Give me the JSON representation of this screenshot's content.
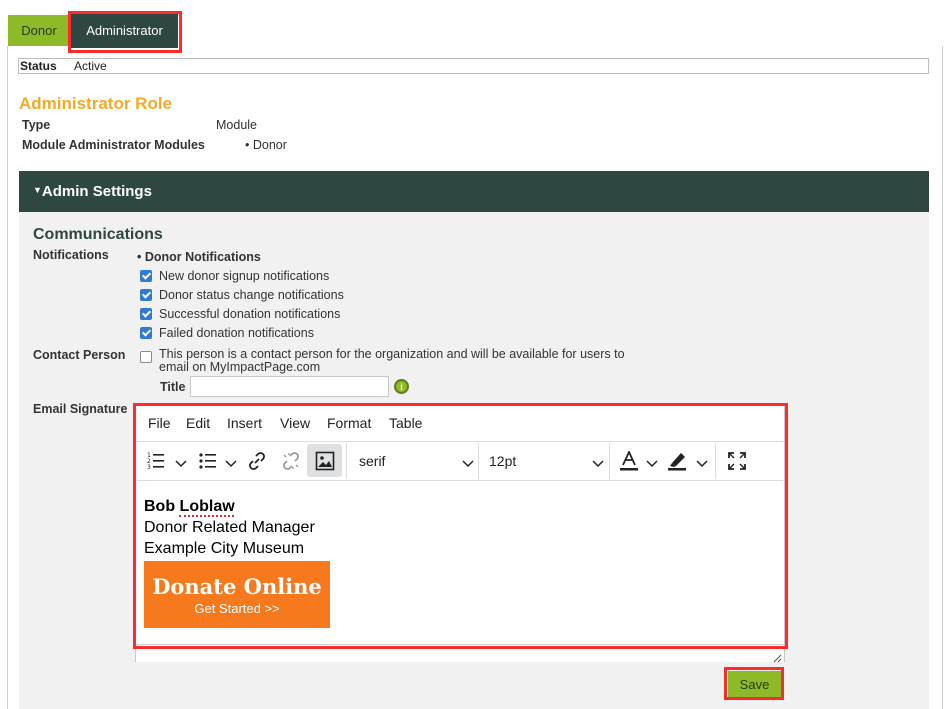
{
  "tabs": [
    {
      "label": "Donor",
      "active": false
    },
    {
      "label": "Administrator",
      "active": true
    }
  ],
  "status": {
    "label": "Status",
    "value": "Active"
  },
  "role": {
    "title": "Administrator Role",
    "type_label": "Type",
    "type_value": "Module",
    "modules_label": "Module Administrator Modules",
    "modules": [
      "Donor"
    ]
  },
  "admin_settings": {
    "header": "Admin Settings",
    "communications_title": "Communications",
    "notifications_label": "Notifications",
    "notification_group": "Donor Notifications",
    "notification_items": [
      {
        "label": "New donor signup notifications",
        "checked": true
      },
      {
        "label": "Donor status change notifications",
        "checked": true
      },
      {
        "label": "Successful donation notifications",
        "checked": true
      },
      {
        "label": "Failed donation notifications",
        "checked": true
      }
    ],
    "contact_label": "Contact Person",
    "contact_checked": false,
    "contact_text_line1": "This person is a contact person for the organization and will be available for users to",
    "contact_text_line2": "email on MyImpactPage.com",
    "title_label": "Title",
    "title_value": "",
    "email_signature_label": "Email Signature"
  },
  "editor": {
    "menu": [
      "File",
      "Edit",
      "Insert",
      "View",
      "Format",
      "Table"
    ],
    "toolbar_icons": [
      "numbered-list-icon",
      "bullet-list-icon",
      "link-icon",
      "unlink-icon",
      "image-icon",
      "text-color-icon",
      "highlight-icon",
      "fullscreen-icon"
    ],
    "font_family": "serif",
    "font_size": "12pt",
    "content": {
      "name": "Bob Loblaw",
      "role": "Donor Related Manager",
      "org": "Example City Museum",
      "donate_title": "Donate Online",
      "donate_sub": "Get Started >>"
    }
  },
  "save_label": "Save",
  "colors": {
    "brand_green": "#8dba29",
    "dark_teal": "#2e4742",
    "orange_title": "#f4a928",
    "donate_orange": "#f7791e",
    "highlight_red": "#ff2b2b"
  }
}
